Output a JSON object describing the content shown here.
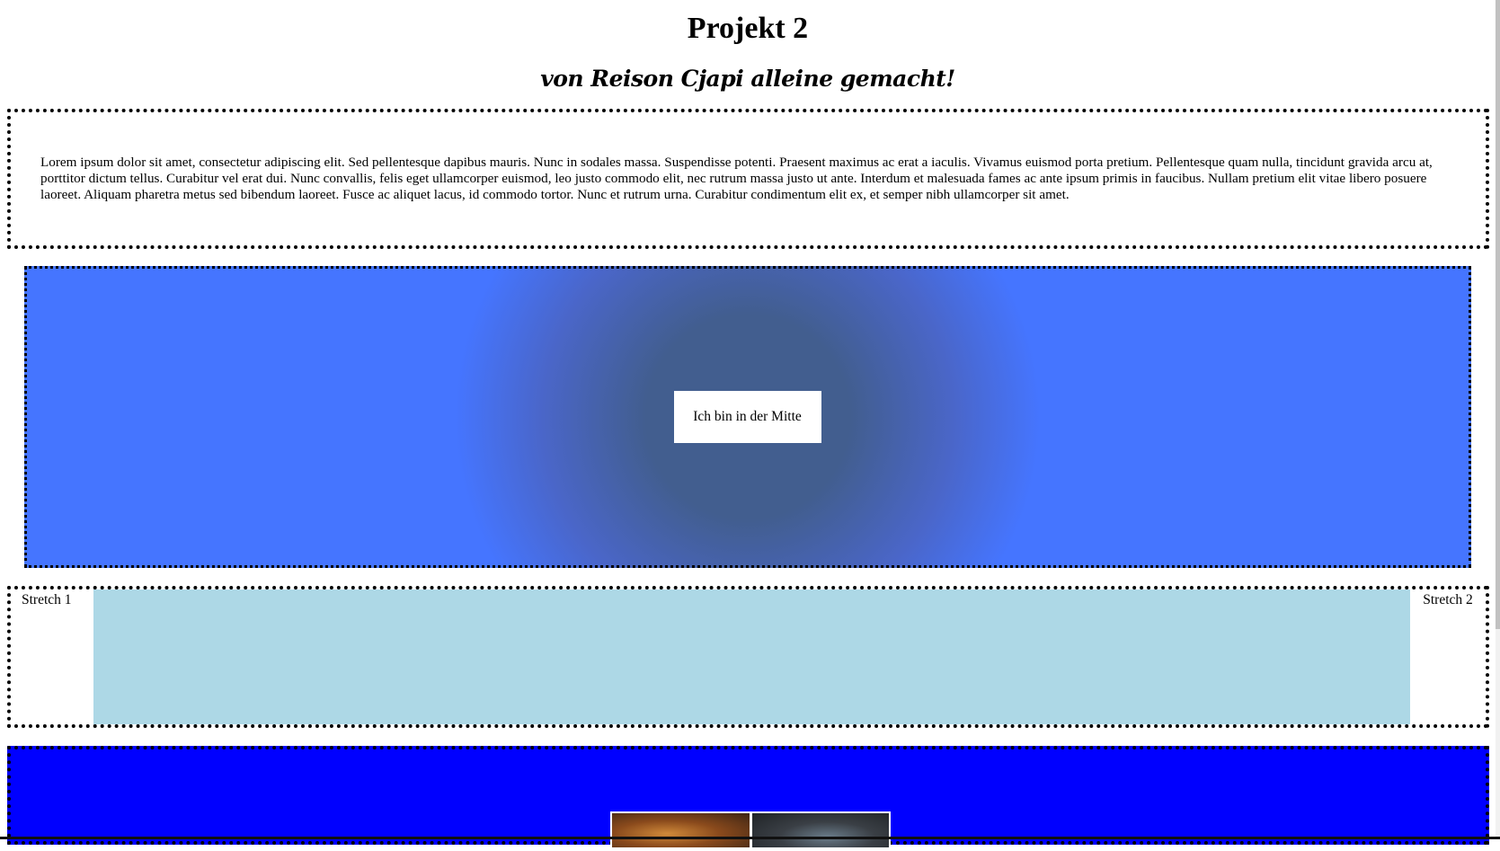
{
  "header": {
    "title": "Projekt 2",
    "subtitle": "von Reison Cjapi alleine gemacht!"
  },
  "intro": {
    "text": "Lorem ipsum dolor sit amet, consectetur adipiscing elit. Sed pellentesque dapibus mauris. Nunc in sodales massa. Suspendisse potenti. Praesent maximus ac erat a iaculis. Vivamus euismod porta pretium. Pellentesque quam nulla, tincidunt gravida arcu at, porttitor dictum tellus. Curabitur vel erat dui. Nunc convallis, felis eget ullamcorper euismod, leo justo commodo elit, nec rutrum massa justo ut ante. Interdum et malesuada fames ac ante ipsum primis in faucibus. Nullam pretium elit vitae libero posuere laoreet. Aliquam pharetra metus sed bibendum laoreet. Fusce ac aliquet lacus, id commodo tortor. Nunc et rutrum urna. Curabitur condimentum elit ex, et semper nibh ullamcorper sit amet."
  },
  "center_section": {
    "label": "Ich bin in der Mitte"
  },
  "stretch_section": {
    "left_label": "Stretch 1",
    "right_label": "Stretch 2"
  },
  "colors": {
    "center_gradient_inner": "#425e8f",
    "center_gradient_outer": "#4575ff",
    "stretch_fill": "#add8e6",
    "gallery_background": "#0000ff"
  },
  "gallery": {
    "images": [
      "food-photo",
      "food-photo"
    ]
  }
}
